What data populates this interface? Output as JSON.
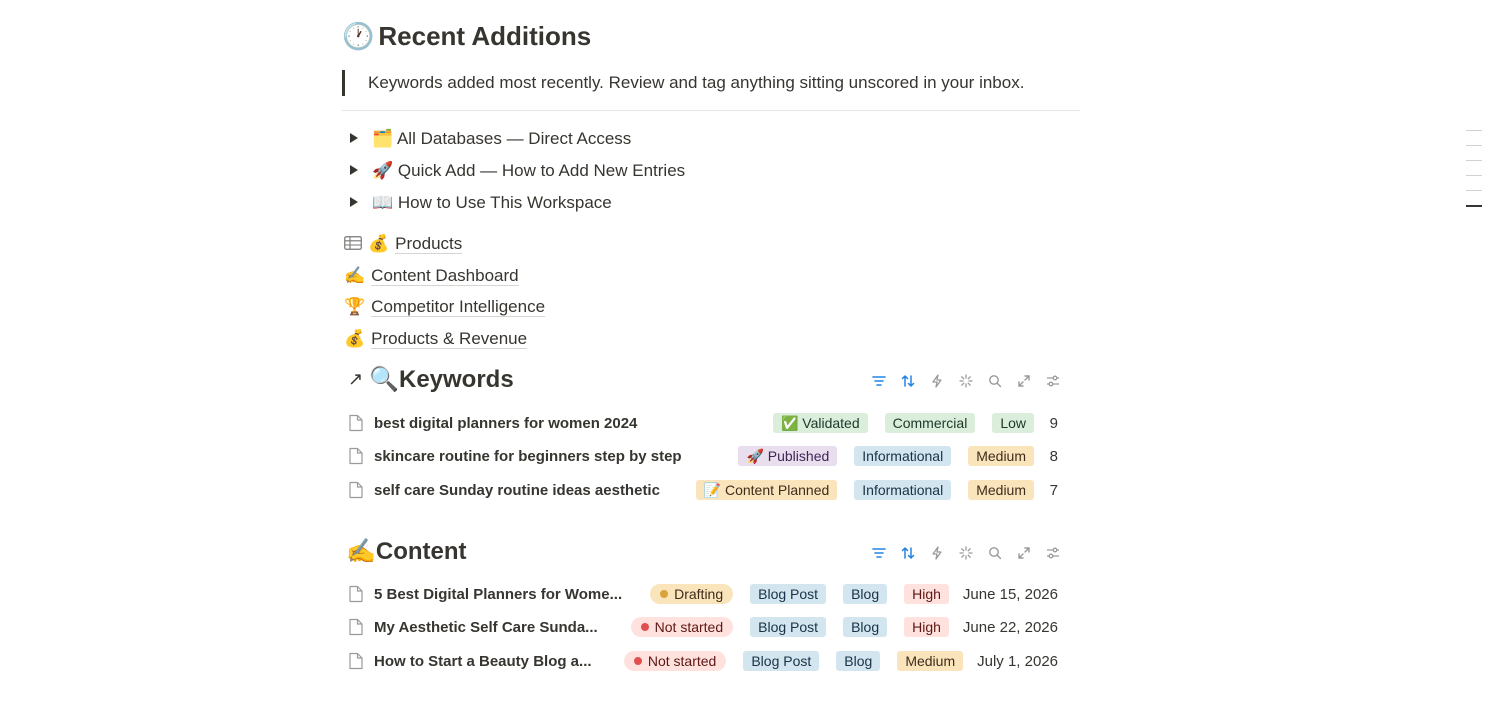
{
  "heading": {
    "emoji": "🕐",
    "text": "Recent Additions"
  },
  "quote": "Keywords added most recently. Review and tag anything sitting unscored in your inbox.",
  "toggles": [
    {
      "emoji": "🗂️",
      "label": "All Databases — Direct Access"
    },
    {
      "emoji": "🚀",
      "label": "Quick Add — How to Add New Entries"
    },
    {
      "emoji": "📖",
      "label": "How to Use This Workspace"
    }
  ],
  "links": [
    {
      "emoji": "💰",
      "label": "Products",
      "icon": "table-icon"
    },
    {
      "emoji": "✍️",
      "label": "Content Dashboard"
    },
    {
      "emoji": "🏆",
      "label": "Competitor Intelligence"
    },
    {
      "emoji": "💰",
      "label": "Products & Revenue"
    }
  ],
  "keywords": {
    "arrow": "↗",
    "emoji": "🔍",
    "title": "Keywords",
    "rows": [
      {
        "title": "best digital planners for women 2024",
        "status": "✅ Validated",
        "intent": "Commercial",
        "difficulty": "Low",
        "score": "9"
      },
      {
        "title": "skincare routine for beginners step by step",
        "status": "🚀 Published",
        "intent": "Informational",
        "difficulty": "Medium",
        "score": "8"
      },
      {
        "title": "self care Sunday routine ideas aesthetic",
        "status": "📝 Content Planned",
        "intent": "Informational",
        "difficulty": "Medium",
        "score": "7"
      }
    ]
  },
  "content": {
    "emoji": "✍️",
    "title": "Content",
    "rows": [
      {
        "title": "5 Best Digital Planners for Wome...",
        "status": "Drafting",
        "type": "Blog Post",
        "channel": "Blog",
        "priority": "High",
        "date": "June 15, 2026"
      },
      {
        "title": "My Aesthetic Self Care Sunda...",
        "status": "Not started",
        "type": "Blog Post",
        "channel": "Blog",
        "priority": "High",
        "date": "June 22, 2026"
      },
      {
        "title": "How to Start a Beauty Blog a...",
        "status": "Not started",
        "type": "Blog Post",
        "channel": "Blog",
        "priority": "Medium",
        "date": "July 1, 2026"
      }
    ]
  },
  "colors": {
    "accent": "#2383e2",
    "text": "#37352f",
    "drafting_dot": "#d9a23a",
    "not_started_dot": "#e15050"
  }
}
